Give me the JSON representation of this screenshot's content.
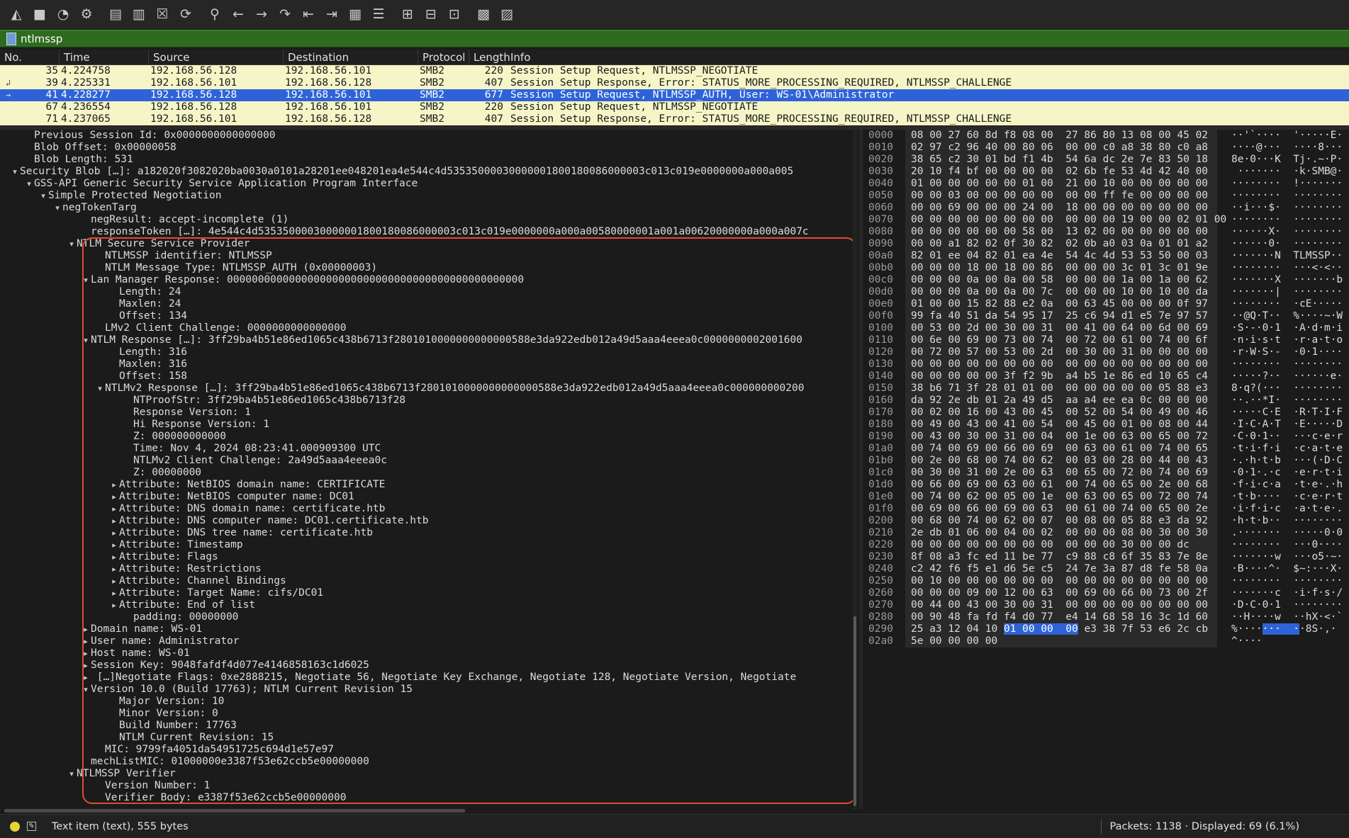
{
  "toolbar": {
    "buttons": [
      {
        "name": "start-capture-icon",
        "glyph": "◭"
      },
      {
        "name": "stop-capture-icon",
        "glyph": "■"
      },
      {
        "name": "restart-capture-icon",
        "glyph": "◔"
      },
      {
        "name": "capture-options-icon",
        "glyph": "⚙"
      },
      {
        "name": "open-file-icon",
        "glyph": "▤"
      },
      {
        "name": "save-file-icon",
        "glyph": "▥"
      },
      {
        "name": "close-file-icon",
        "glyph": "☒"
      },
      {
        "name": "reload-file-icon",
        "glyph": "⟳"
      },
      {
        "name": "find-packet-icon",
        "glyph": "⚲"
      },
      {
        "name": "go-back-icon",
        "glyph": "←"
      },
      {
        "name": "go-forward-icon",
        "glyph": "→"
      },
      {
        "name": "go-to-packet-icon",
        "glyph": "↷"
      },
      {
        "name": "first-packet-icon",
        "glyph": "⇤"
      },
      {
        "name": "last-packet-icon",
        "glyph": "⇥"
      },
      {
        "name": "auto-scroll-icon",
        "glyph": "▦"
      },
      {
        "name": "colorize-icon",
        "glyph": "☰"
      },
      {
        "name": "zoom-in-icon",
        "glyph": "⊞"
      },
      {
        "name": "zoom-out-icon",
        "glyph": "⊟"
      },
      {
        "name": "normal-size-icon",
        "glyph": "⊡"
      },
      {
        "name": "resize-columns-icon",
        "glyph": "▩"
      },
      {
        "name": "layout-icon",
        "glyph": "▨"
      }
    ]
  },
  "filter": {
    "value": "ntlmssp"
  },
  "columns": [
    "No.",
    "Time",
    "Source",
    "Destination",
    "Protocol",
    "Length",
    "Info"
  ],
  "packets": [
    {
      "no": "35",
      "time": "4.224758",
      "src": "192.168.56.128",
      "dst": "192.168.56.101",
      "proto": "SMB2",
      "len": "220",
      "info": "Session Setup Request, NTLMSSP_NEGOTIATE",
      "rel": "",
      "selected": false
    },
    {
      "no": "39",
      "time": "4.225331",
      "src": "192.168.56.101",
      "dst": "192.168.56.128",
      "proto": "SMB2",
      "len": "407",
      "info": "Session Setup Response, Error: STATUS_MORE_PROCESSING_REQUIRED, NTLMSSP_CHALLENGE",
      "rel": "↲",
      "selected": false
    },
    {
      "no": "41",
      "time": "4.228277",
      "src": "192.168.56.128",
      "dst": "192.168.56.101",
      "proto": "SMB2",
      "len": "677",
      "info": "Session Setup Request, NTLMSSP_AUTH, User: WS-01\\Administrator",
      "rel": "→",
      "selected": true
    },
    {
      "no": "67",
      "time": "4.236554",
      "src": "192.168.56.128",
      "dst": "192.168.56.101",
      "proto": "SMB2",
      "len": "220",
      "info": "Session Setup Request, NTLMSSP_NEGOTIATE",
      "rel": "",
      "selected": false
    },
    {
      "no": "71",
      "time": "4.237065",
      "src": "192.168.56.101",
      "dst": "192.168.56.128",
      "proto": "SMB2",
      "len": "407",
      "info": "Session Setup Response, Error: STATUS_MORE_PROCESSING_REQUIRED, NTLMSSP_CHALLENGE",
      "rel": "",
      "selected": false
    }
  ],
  "details": [
    {
      "d": 3,
      "a": "",
      "t": "Previous Session Id: 0x0000000000000000"
    },
    {
      "d": 3,
      "a": "",
      "t": "Blob Offset: 0x00000058"
    },
    {
      "d": 3,
      "a": "",
      "t": "Blob Length: 531"
    },
    {
      "d": 2,
      "a": "open",
      "t": "Security Blob […]: a182020f3082020ba0030a0101a28201ee048201ea4e544c4d53535000030000001800180086000003c013c019e0000000a000a005"
    },
    {
      "d": 3,
      "a": "open",
      "t": "GSS-API Generic Security Service Application Program Interface"
    },
    {
      "d": 4,
      "a": "open",
      "t": "Simple Protected Negotiation"
    },
    {
      "d": 5,
      "a": "open",
      "t": "negTokenTarg"
    },
    {
      "d": 7,
      "a": "",
      "t": "negResult: accept-incomplete (1)"
    },
    {
      "d": 7,
      "a": "",
      "t": "responseToken […]: 4e544c4d53535000030000001800180086000003c013c019e0000000a000a00580000001a001a00620000000a000a007c"
    },
    {
      "d": 6,
      "a": "open",
      "t": "NTLM Secure Service Provider"
    },
    {
      "d": 8,
      "a": "",
      "t": "NTLMSSP identifier: NTLMSSP"
    },
    {
      "d": 8,
      "a": "",
      "t": "NTLM Message Type: NTLMSSP_AUTH (0x00000003)"
    },
    {
      "d": 7,
      "a": "open",
      "t": "Lan Manager Response: 000000000000000000000000000000000000000000000000"
    },
    {
      "d": 9,
      "a": "",
      "t": "Length: 24"
    },
    {
      "d": 9,
      "a": "",
      "t": "Maxlen: 24"
    },
    {
      "d": 9,
      "a": "",
      "t": "Offset: 134"
    },
    {
      "d": 8,
      "a": "",
      "t": "LMv2 Client Challenge: 0000000000000000"
    },
    {
      "d": 7,
      "a": "open",
      "t": "NTLM Response […]: 3ff29ba4b51e86ed1065c438b6713f2801010000000000000588e3da922edb012a49d5aaa4eeea0c0000000002001600"
    },
    {
      "d": 9,
      "a": "",
      "t": "Length: 316"
    },
    {
      "d": 9,
      "a": "",
      "t": "Maxlen: 316"
    },
    {
      "d": 9,
      "a": "",
      "t": "Offset: 158"
    },
    {
      "d": 8,
      "a": "open",
      "t": "NTLMv2 Response […]: 3ff29ba4b51e86ed1065c438b6713f2801010000000000000588e3da922edb012a49d5aaa4eeea0c000000000200"
    },
    {
      "d": 10,
      "a": "",
      "t": "NTProofStr: 3ff29ba4b51e86ed1065c438b6713f28"
    },
    {
      "d": 10,
      "a": "",
      "t": "Response Version: 1"
    },
    {
      "d": 10,
      "a": "",
      "t": "Hi Response Version: 1"
    },
    {
      "d": 10,
      "a": "",
      "t": "Z: 000000000000"
    },
    {
      "d": 10,
      "a": "",
      "t": "Time: Nov  4, 2024 08:23:41.000909300 UTC"
    },
    {
      "d": 10,
      "a": "",
      "t": "NTLMv2 Client Challenge: 2a49d5aaa4eeea0c"
    },
    {
      "d": 10,
      "a": "",
      "t": "Z: 00000000"
    },
    {
      "d": 9,
      "a": "closed",
      "t": "Attribute: NetBIOS domain name: CERTIFICATE"
    },
    {
      "d": 9,
      "a": "closed",
      "t": "Attribute: NetBIOS computer name: DC01"
    },
    {
      "d": 9,
      "a": "closed",
      "t": "Attribute: DNS domain name: certificate.htb"
    },
    {
      "d": 9,
      "a": "closed",
      "t": "Attribute: DNS computer name: DC01.certificate.htb"
    },
    {
      "d": 9,
      "a": "closed",
      "t": "Attribute: DNS tree name: certificate.htb"
    },
    {
      "d": 9,
      "a": "closed",
      "t": "Attribute: Timestamp"
    },
    {
      "d": 9,
      "a": "closed",
      "t": "Attribute: Flags"
    },
    {
      "d": 9,
      "a": "closed",
      "t": "Attribute: Restrictions"
    },
    {
      "d": 9,
      "a": "closed",
      "t": "Attribute: Channel Bindings"
    },
    {
      "d": 9,
      "a": "closed",
      "t": "Attribute: Target Name: cifs/DC01"
    },
    {
      "d": 9,
      "a": "closed",
      "t": "Attribute: End of list"
    },
    {
      "d": 10,
      "a": "",
      "t": "padding: 00000000"
    },
    {
      "d": 7,
      "a": "closed",
      "t": "Domain name: WS-01"
    },
    {
      "d": 7,
      "a": "closed",
      "t": "User name: Administrator"
    },
    {
      "d": 7,
      "a": "closed",
      "t": "Host name: WS-01"
    },
    {
      "d": 7,
      "a": "closed",
      "t": "Session Key: 9048fafdf4d077e4146858163c1d6025"
    },
    {
      "d": 7,
      "a": "closed",
      "t": " […]Negotiate Flags: 0xe2888215, Negotiate 56, Negotiate Key Exchange, Negotiate 128, Negotiate Version, Negotiate"
    },
    {
      "d": 7,
      "a": "open",
      "t": "Version 10.0 (Build 17763); NTLM Current Revision 15"
    },
    {
      "d": 9,
      "a": "",
      "t": "Major Version: 10"
    },
    {
      "d": 9,
      "a": "",
      "t": "Minor Version: 0"
    },
    {
      "d": 9,
      "a": "",
      "t": "Build Number: 17763"
    },
    {
      "d": 9,
      "a": "",
      "t": "NTLM Current Revision: 15"
    },
    {
      "d": 8,
      "a": "",
      "t": "MIC: 9799fa4051da54951725c694d1e57e97"
    },
    {
      "d": 7,
      "a": "",
      "t": "mechListMIC: 01000000e3387f53e62ccb5e00000000"
    },
    {
      "d": 6,
      "a": "open",
      "t": "NTLMSSP Verifier"
    },
    {
      "d": 8,
      "a": "",
      "t": "Version Number: 1"
    },
    {
      "d": 8,
      "a": "",
      "t": "Verifier Body: e3387f53e62ccb5e00000000"
    }
  ],
  "bytes": [
    {
      "off": "0000",
      "hex": "08 00 27 60 8d f8 08 00  27 86 80 13 08 00 45 02",
      "ascii": "··'`····  '·····E·"
    },
    {
      "off": "0010",
      "hex": "02 97 c2 96 40 00 80 06  00 00 c0 a8 38 80 c0 a8",
      "ascii": "····@···  ····8···"
    },
    {
      "off": "0020",
      "hex": "38 65 c2 30 01 bd f1 4b  54 6a dc 2e 7e 83 50 18",
      "ascii": "8e·0···K  Tj·.~·P·"
    },
    {
      "off": "0030",
      "hex": "20 10 f4 bf 00 00 00 00  02 6b fe 53 4d 42 40 00",
      "ascii": " ·······  ·k·SMB@·"
    },
    {
      "off": "0040",
      "hex": "01 00 00 00 00 00 01 00  21 00 10 00 00 00 00 00",
      "ascii": "········  !·······"
    },
    {
      "off": "0050",
      "hex": "00 00 03 00 00 00 00 00  00 00 ff fe 00 00 00 00",
      "ascii": "········  ········"
    },
    {
      "off": "0060",
      "hex": "00 00 69 00 00 00 24 00  18 00 00 00 00 00 00 00",
      "ascii": "··i···$·  ········"
    },
    {
      "off": "0070",
      "hex": "00 00 00 00 00 00 00 00  00 00 00 19 00 00 02 01 00",
      "ascii": "········  ········"
    },
    {
      "off": "0080",
      "hex": "00 00 00 00 00 00 58 00  13 02 00 00 00 00 00 00",
      "ascii": "······X·  ········"
    },
    {
      "off": "0090",
      "hex": "00 00 a1 82 02 0f 30 82  02 0b a0 03 0a 01 01 a2",
      "ascii": "······0·  ········"
    },
    {
      "off": "00a0",
      "hex": "82 01 ee 04 82 01 ea 4e  54 4c 4d 53 53 50 00 03",
      "ascii": "·······N  TLMSSP··"
    },
    {
      "off": "00b0",
      "hex": "00 00 00 18 00 18 00 86  00 00 00 3c 01 3c 01 9e",
      "ascii": "········  ···<·<··"
    },
    {
      "off": "00c0",
      "hex": "00 00 00 0a 00 0a 00 58  00 00 00 1a 00 1a 00 62",
      "ascii": "·······X  ·······b"
    },
    {
      "off": "00d0",
      "hex": "00 00 00 0a 00 0a 00 7c  00 00 00 10 00 10 00 da",
      "ascii": "·······|  ········"
    },
    {
      "off": "00e0",
      "hex": "01 00 00 15 82 88 e2 0a  00 63 45 00 00 00 0f 97",
      "ascii": "········  ·cE·····"
    },
    {
      "off": "00f0",
      "hex": "99 fa 40 51 da 54 95 17  25 c6 94 d1 e5 7e 97 57",
      "ascii": "··@Q·T··  %····~·W"
    },
    {
      "off": "0100",
      "hex": "00 53 00 2d 00 30 00 31  00 41 00 64 00 6d 00 69",
      "ascii": "·S·-·0·1  ·A·d·m·i"
    },
    {
      "off": "0110",
      "hex": "00 6e 00 69 00 73 00 74  00 72 00 61 00 74 00 6f",
      "ascii": "·n·i·s·t  ·r·a·t·o"
    },
    {
      "off": "0120",
      "hex": "00 72 00 57 00 53 00 2d  00 30 00 31 00 00 00 00",
      "ascii": "·r·W·S·-  ·0·1····"
    },
    {
      "off": "0130",
      "hex": "00 00 00 00 00 00 00 00  00 00 00 00 00 00 00 00",
      "ascii": "········  ········"
    },
    {
      "off": "0140",
      "hex": "00 00 00 00 00 3f f2 9b  a4 b5 1e 86 ed 10 65 c4",
      "ascii": "·····?··  ······e·"
    },
    {
      "off": "0150",
      "hex": "38 b6 71 3f 28 01 01 00  00 00 00 00 00 05 88 e3",
      "ascii": "8·q?(···  ········"
    },
    {
      "off": "0160",
      "hex": "da 92 2e db 01 2a 49 d5  aa a4 ee ea 0c 00 00 00",
      "ascii": "··.··*I·  ········"
    },
    {
      "off": "0170",
      "hex": "00 02 00 16 00 43 00 45  00 52 00 54 00 49 00 46",
      "ascii": "·····C·E  ·R·T·I·F"
    },
    {
      "off": "0180",
      "hex": "00 49 00 43 00 41 00 54  00 45 00 01 00 08 00 44",
      "ascii": "·I·C·A·T  ·E·····D"
    },
    {
      "off": "0190",
      "hex": "00 43 00 30 00 31 00 04  00 1e 00 63 00 65 00 72",
      "ascii": "·C·0·1··  ···c·e·r"
    },
    {
      "off": "01a0",
      "hex": "00 74 00 69 00 66 00 69  00 63 00 61 00 74 00 65",
      "ascii": "·t·i·f·i  ·c·a·t·e"
    },
    {
      "off": "01b0",
      "hex": "00 2e 00 68 00 74 00 62  00 03 00 28 00 44 00 43",
      "ascii": "·.·h·t·b  ···(·D·C"
    },
    {
      "off": "01c0",
      "hex": "00 30 00 31 00 2e 00 63  00 65 00 72 00 74 00 69",
      "ascii": "·0·1·.·c  ·e·r·t·i"
    },
    {
      "off": "01d0",
      "hex": "00 66 00 69 00 63 00 61  00 74 00 65 00 2e 00 68",
      "ascii": "·f·i·c·a  ·t·e·.·h"
    },
    {
      "off": "01e0",
      "hex": "00 74 00 62 00 05 00 1e  00 63 00 65 00 72 00 74",
      "ascii": "·t·b····  ·c·e·r·t"
    },
    {
      "off": "01f0",
      "hex": "00 69 00 66 00 69 00 63  00 61 00 74 00 65 00 2e",
      "ascii": "·i·f·i·c  ·a·t·e·."
    },
    {
      "off": "0200",
      "hex": "00 68 00 74 00 62 00 07  00 08 00 05 88 e3 da 92",
      "ascii": "·h·t·b··  ········"
    },
    {
      "off": "0210",
      "hex": "2e db 01 06 00 04 00 02  00 00 00 08 00 30 00 30",
      "ascii": ".·······  ·····0·0"
    },
    {
      "off": "0220",
      "hex": "00 00 00 00 00 00 00 00  00 00 00 30 00 00 dc",
      "ascii": "········  ···0····"
    },
    {
      "off": "0230",
      "hex": "8f 08 a3 fc ed 11 be 77  c9 88 c8 6f 35 83 7e 8e",
      "ascii": "·······w  ···o5·~·"
    },
    {
      "off": "0240",
      "hex": "c2 42 f6 f5 e1 d6 5e c5  24 7e 3a 87 d8 fe 58 0a",
      "ascii": "·B····^·  $~:···X·"
    },
    {
      "off": "0250",
      "hex": "00 10 00 00 00 00 00 00  00 00 00 00 00 00 00 00",
      "ascii": "········  ········"
    },
    {
      "off": "0260",
      "hex": "00 00 00 09 00 12 00 63  00 69 00 66 00 73 00 2f",
      "ascii": "·······c  ·i·f·s·/"
    },
    {
      "off": "0270",
      "hex": "00 44 00 43 00 30 00 31  00 00 00 00 00 00 00 00",
      "ascii": "·D·C·0·1  ········"
    },
    {
      "off": "0280",
      "hex": "00 90 48 fa fd f4 d0 77  e4 14 68 58 16 3c 1d 60",
      "ascii": "··H····w  ··hX·<·`"
    },
    {
      "off": "0290",
      "hex_pre": "25 a3 12 04 10 ",
      "hex_hl": "01 00 00  00",
      "hex_post": " e3 38 7f 53 e6 2c cb",
      "ascii_pre": "%····",
      "ascii_hl": "···  ·",
      "ascii_post": "·8S·,·"
    },
    {
      "off": "02a0",
      "hex": "5e 00 00 00 00",
      "ascii": "^····"
    }
  ],
  "status": {
    "text": "Text item (text), 555 bytes",
    "packets": "Packets: 1138 · Displayed: 69 (6.1%)"
  }
}
